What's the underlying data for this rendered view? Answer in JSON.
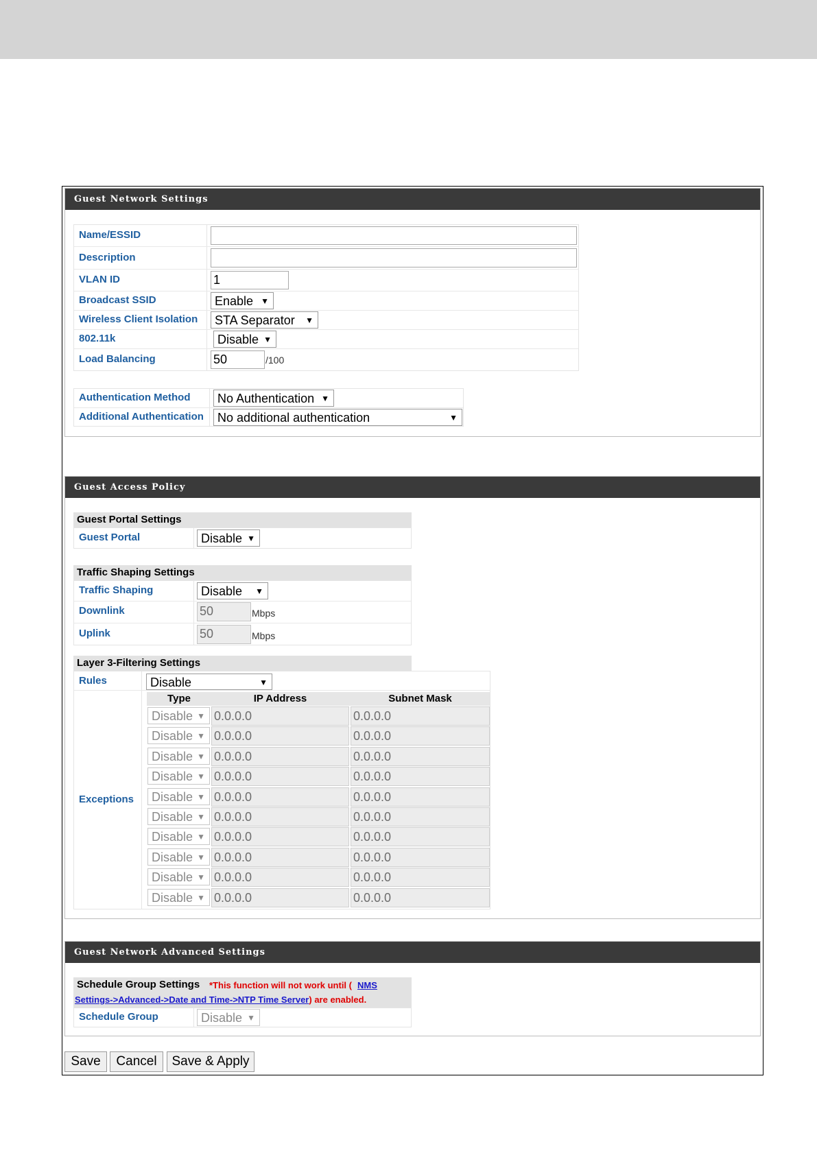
{
  "guest_network_settings": {
    "title": "Guest Network Settings",
    "fields": {
      "name_essid": {
        "label": "Name/ESSID",
        "value": ""
      },
      "description": {
        "label": "Description",
        "value": ""
      },
      "vlan_id": {
        "label": "VLAN ID",
        "value": "1"
      },
      "broadcast_ssid": {
        "label": "Broadcast SSID",
        "value": "Enable"
      },
      "wireless_client_isolation": {
        "label": "Wireless Client Isolation",
        "value": "STA Separator"
      },
      "dot11k": {
        "label": "802.11k",
        "value": "Disable"
      },
      "load_balancing": {
        "label": "Load Balancing",
        "value": "50",
        "suffix": "/100"
      }
    },
    "auth": {
      "method": {
        "label": "Authentication Method",
        "value": "No Authentication"
      },
      "additional": {
        "label": "Additional Authentication",
        "value": "No additional authentication"
      }
    }
  },
  "guest_access_policy": {
    "title": "Guest Access Policy",
    "portal": {
      "header": "Guest Portal Settings",
      "label": "Guest Portal",
      "value": "Disable"
    },
    "traffic": {
      "header": "Traffic Shaping Settings",
      "shaping": {
        "label": "Traffic Shaping",
        "value": "Disable"
      },
      "downlink": {
        "label": "Downlink",
        "value": "50",
        "unit": "Mbps"
      },
      "uplink": {
        "label": "Uplink",
        "value": "50",
        "unit": "Mbps"
      }
    },
    "layer3": {
      "header": "Layer 3-Filtering Settings",
      "rules": {
        "label": "Rules",
        "value": "Disable"
      },
      "exceptions_label": "Exceptions",
      "columns": [
        "Type",
        "IP Address",
        "Subnet Mask"
      ],
      "rows": [
        {
          "type": "Disable",
          "ip": "0.0.0.0",
          "mask": "0.0.0.0"
        },
        {
          "type": "Disable",
          "ip": "0.0.0.0",
          "mask": "0.0.0.0"
        },
        {
          "type": "Disable",
          "ip": "0.0.0.0",
          "mask": "0.0.0.0"
        },
        {
          "type": "Disable",
          "ip": "0.0.0.0",
          "mask": "0.0.0.0"
        },
        {
          "type": "Disable",
          "ip": "0.0.0.0",
          "mask": "0.0.0.0"
        },
        {
          "type": "Disable",
          "ip": "0.0.0.0",
          "mask": "0.0.0.0"
        },
        {
          "type": "Disable",
          "ip": "0.0.0.0",
          "mask": "0.0.0.0"
        },
        {
          "type": "Disable",
          "ip": "0.0.0.0",
          "mask": "0.0.0.0"
        },
        {
          "type": "Disable",
          "ip": "0.0.0.0",
          "mask": "0.0.0.0"
        },
        {
          "type": "Disable",
          "ip": "0.0.0.0",
          "mask": "0.0.0.0"
        }
      ]
    }
  },
  "advanced": {
    "title": "Guest Network Advanced Settings",
    "schedule_header": "Schedule Group Settings",
    "warning_prefix": "*This function will not work until (",
    "warning_link_1": "NMS",
    "warning_link_2": "Settings->Advanced->Date and Time->NTP Time Server",
    "warning_suffix": ") are enabled.",
    "schedule_group": {
      "label": "Schedule Group",
      "value": "Disable"
    }
  },
  "buttons": {
    "save": "Save",
    "cancel": "Cancel",
    "save_apply": "Save & Apply"
  }
}
